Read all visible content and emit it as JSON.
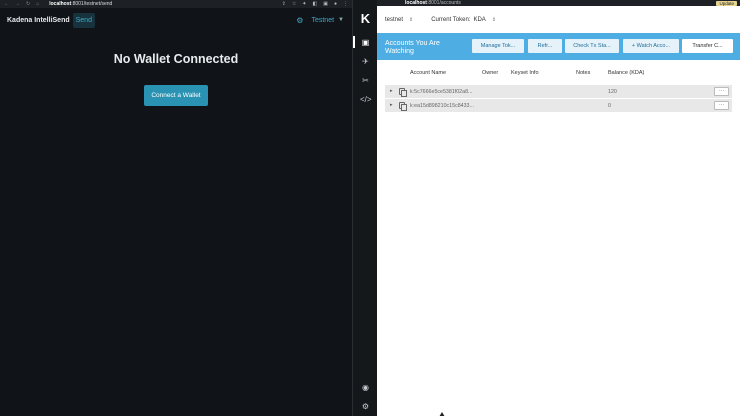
{
  "left_browser": {
    "nav_glyphs": [
      "←",
      "→",
      "↻",
      "⌂"
    ],
    "url_host": "localhost",
    "url_path": ":8001/testnet/send",
    "tool_glyphs": [
      "⇪",
      "☆",
      "✦",
      "◧",
      "▣",
      "●",
      "⋮"
    ]
  },
  "app": {
    "brand": "Kadena IntelliSend",
    "nav_send": "Send",
    "network_label": "Testnet",
    "gear_icon": "gear-icon",
    "heading": "No Wallet Connected",
    "connect_label": "Connect a Wallet"
  },
  "wallet_sidebar": {
    "logo": "K",
    "icons": [
      "accounts-icon",
      "network-icon",
      "tools-icon",
      "code-icon",
      "network-status-icon",
      "settings-icon"
    ]
  },
  "wallet": {
    "url_host": "localhost",
    "url_path": ":8001/accounts",
    "update_label": "Update",
    "network_select": "testnet",
    "token_label": "Current Token:",
    "token_value": "KDA",
    "banner_title": "Accounts You Are Watching",
    "buttons": {
      "manage_tokens": "Manage Tok...",
      "refresh": "Refr...",
      "check_tx": "Check Tx Sta...",
      "watch_account": "+ Watch Acco...",
      "transfer": "Transfer C..."
    },
    "columns": [
      "Account Name",
      "Owner",
      "Keyset Info",
      "Notes",
      "Balance (KDA)"
    ],
    "rows": [
      {
        "account": "k:5c7666e5ce5381f02a8...",
        "balance": "120",
        "more": "···"
      },
      {
        "account": "k:ea15d898210c15c8433...",
        "balance": "0",
        "more": "···"
      }
    ],
    "colors": {
      "banner": "#4eaee3",
      "accent": "#2a93b3"
    }
  }
}
